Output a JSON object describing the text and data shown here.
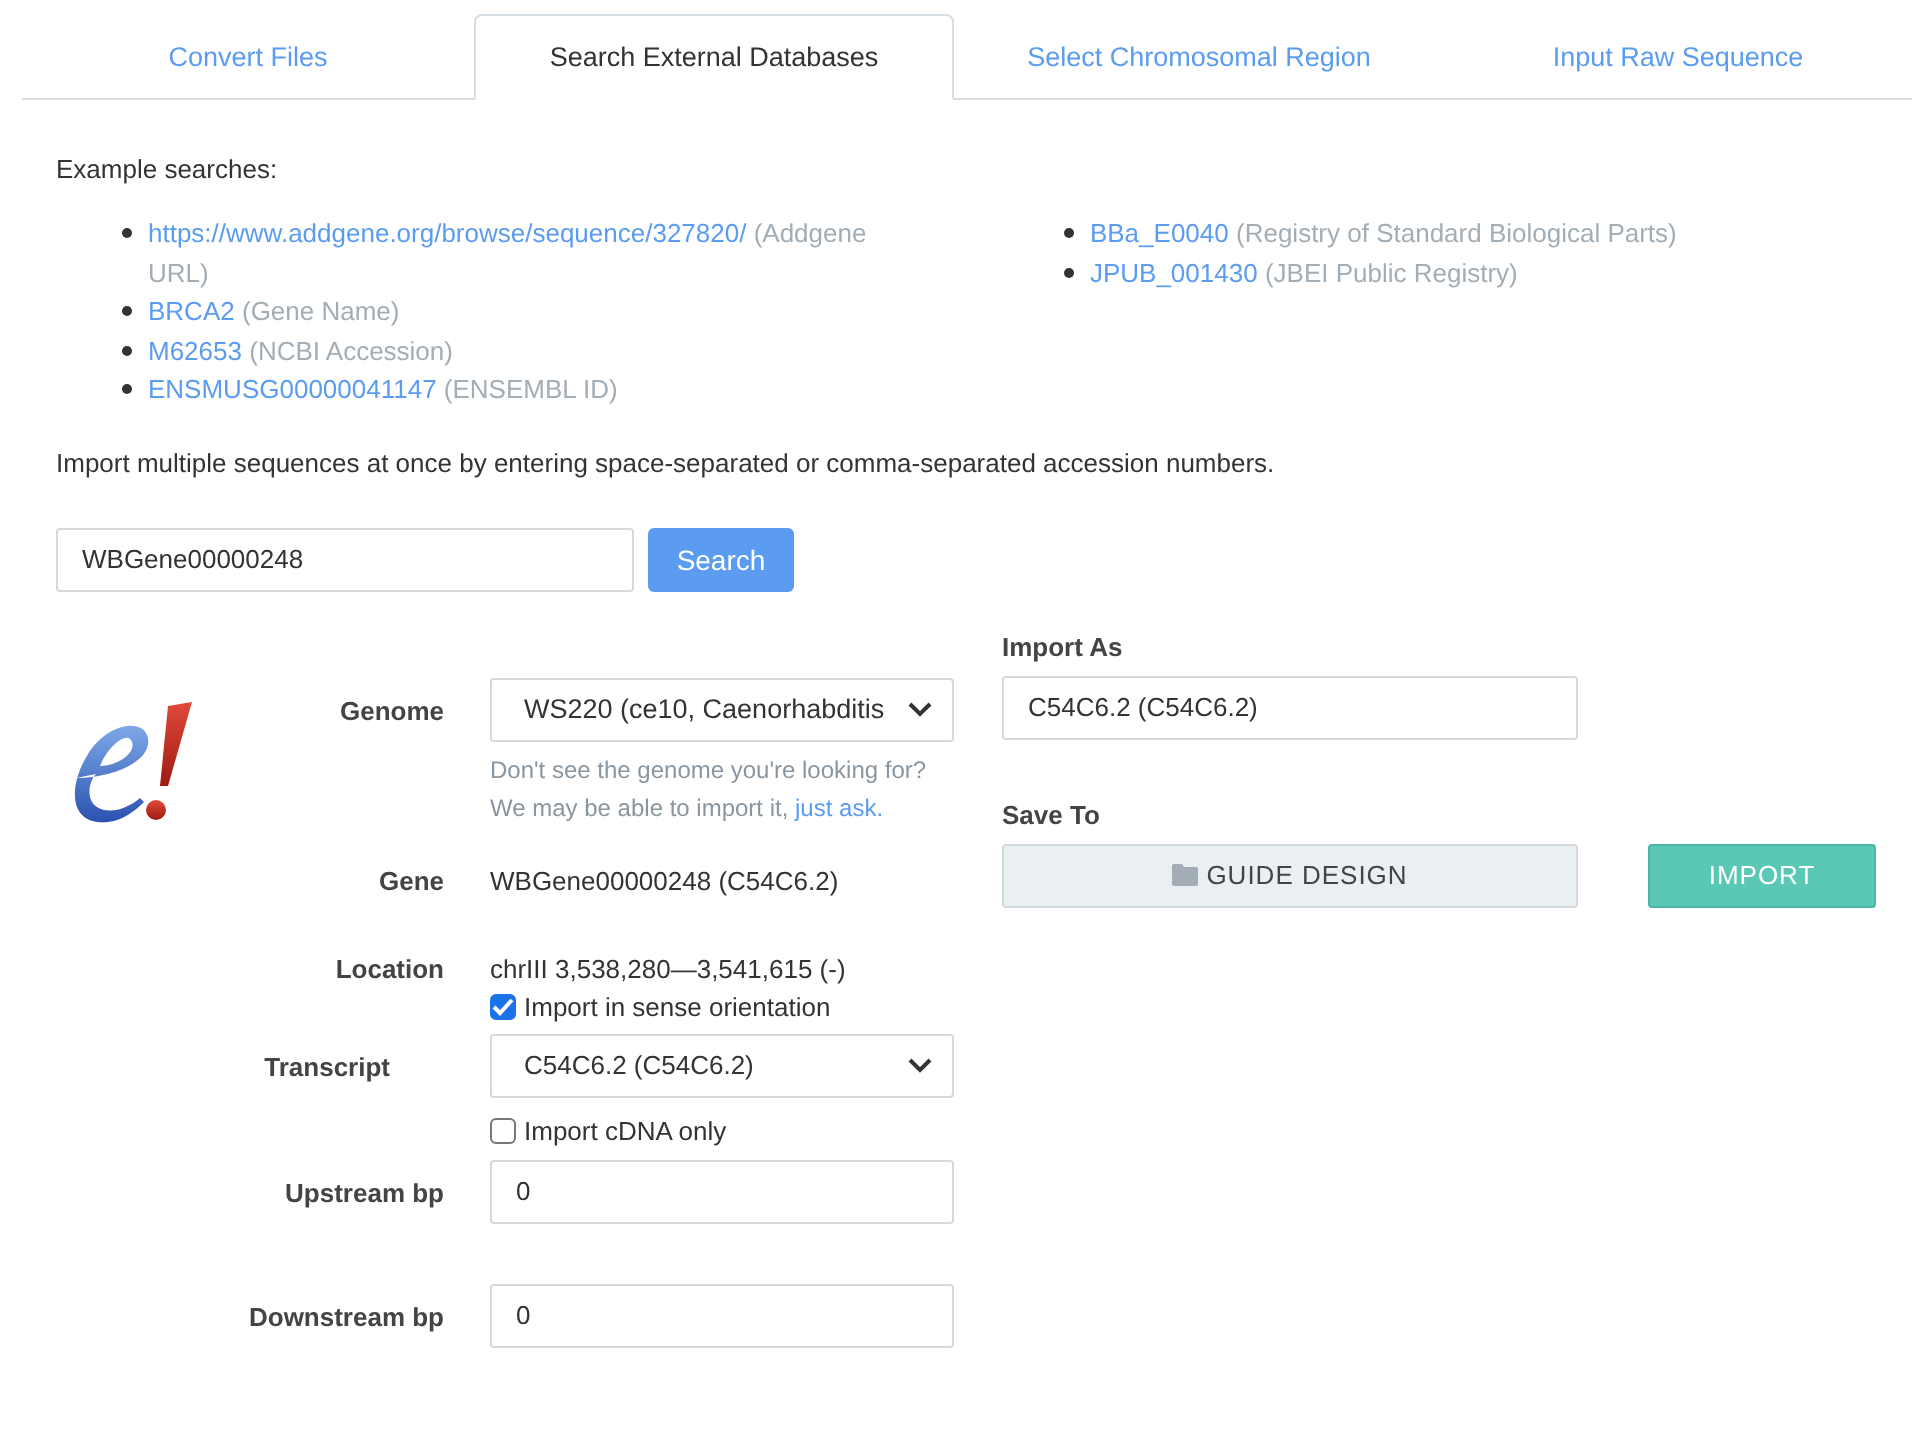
{
  "tabs": [
    {
      "label": "Convert Files",
      "selected": false
    },
    {
      "label": "Search External Databases",
      "selected": true
    },
    {
      "label": "Select Chromosomal Region",
      "selected": false
    },
    {
      "label": "Input Raw Sequence",
      "selected": false
    }
  ],
  "examples_heading": "Example searches:",
  "examples_left": [
    {
      "link": "https://www.addgene.org/browse/sequence/327820/",
      "note": "(Addgene URL)"
    },
    {
      "link": "BRCA2",
      "note": "(Gene Name)"
    },
    {
      "link": "M62653",
      "note": "(NCBI Accession)"
    },
    {
      "link": "ENSMUSG00000041147",
      "note": "(ENSEMBL ID)"
    }
  ],
  "examples_right": [
    {
      "link": "BBa_E0040",
      "note": "(Registry of Standard Biological Parts)"
    },
    {
      "link": "JPUB_001430",
      "note": "(JBEI Public Registry)"
    }
  ],
  "multi_hint": "Import multiple sequences at once by entering space-separated or comma-separated accession numbers.",
  "search": {
    "value": "WBGene00000248",
    "button": "Search"
  },
  "genome": {
    "label": "Genome",
    "value": "WS220 (ce10, Caenorhabditis",
    "help_line_1": "Don't see the genome you're looking for?",
    "help_line_2": "We may be able to import it,",
    "help_link": "just ask."
  },
  "gene": {
    "label": "Gene",
    "value": "WBGene00000248 (C54C6.2)"
  },
  "location": {
    "label": "Location",
    "value": "chrIII 3,538,280—3,541,615 (-)",
    "checkbox": {
      "label": "Import in sense orientation",
      "checked": true
    }
  },
  "transcript": {
    "label": "Transcript",
    "value": "C54C6.2 (C54C6.2)",
    "checkbox": {
      "label": "Import cDNA only",
      "checked": false
    }
  },
  "upstream": {
    "label": "Upstream bp",
    "value": "0"
  },
  "downstream": {
    "label": "Downstream bp",
    "value": "0"
  },
  "import_as": {
    "label": "Import As",
    "value": "C54C6.2 (C54C6.2)"
  },
  "save_to": {
    "label": "Save To",
    "folder": "GUIDE DESIGN"
  },
  "import_button": "IMPORT"
}
